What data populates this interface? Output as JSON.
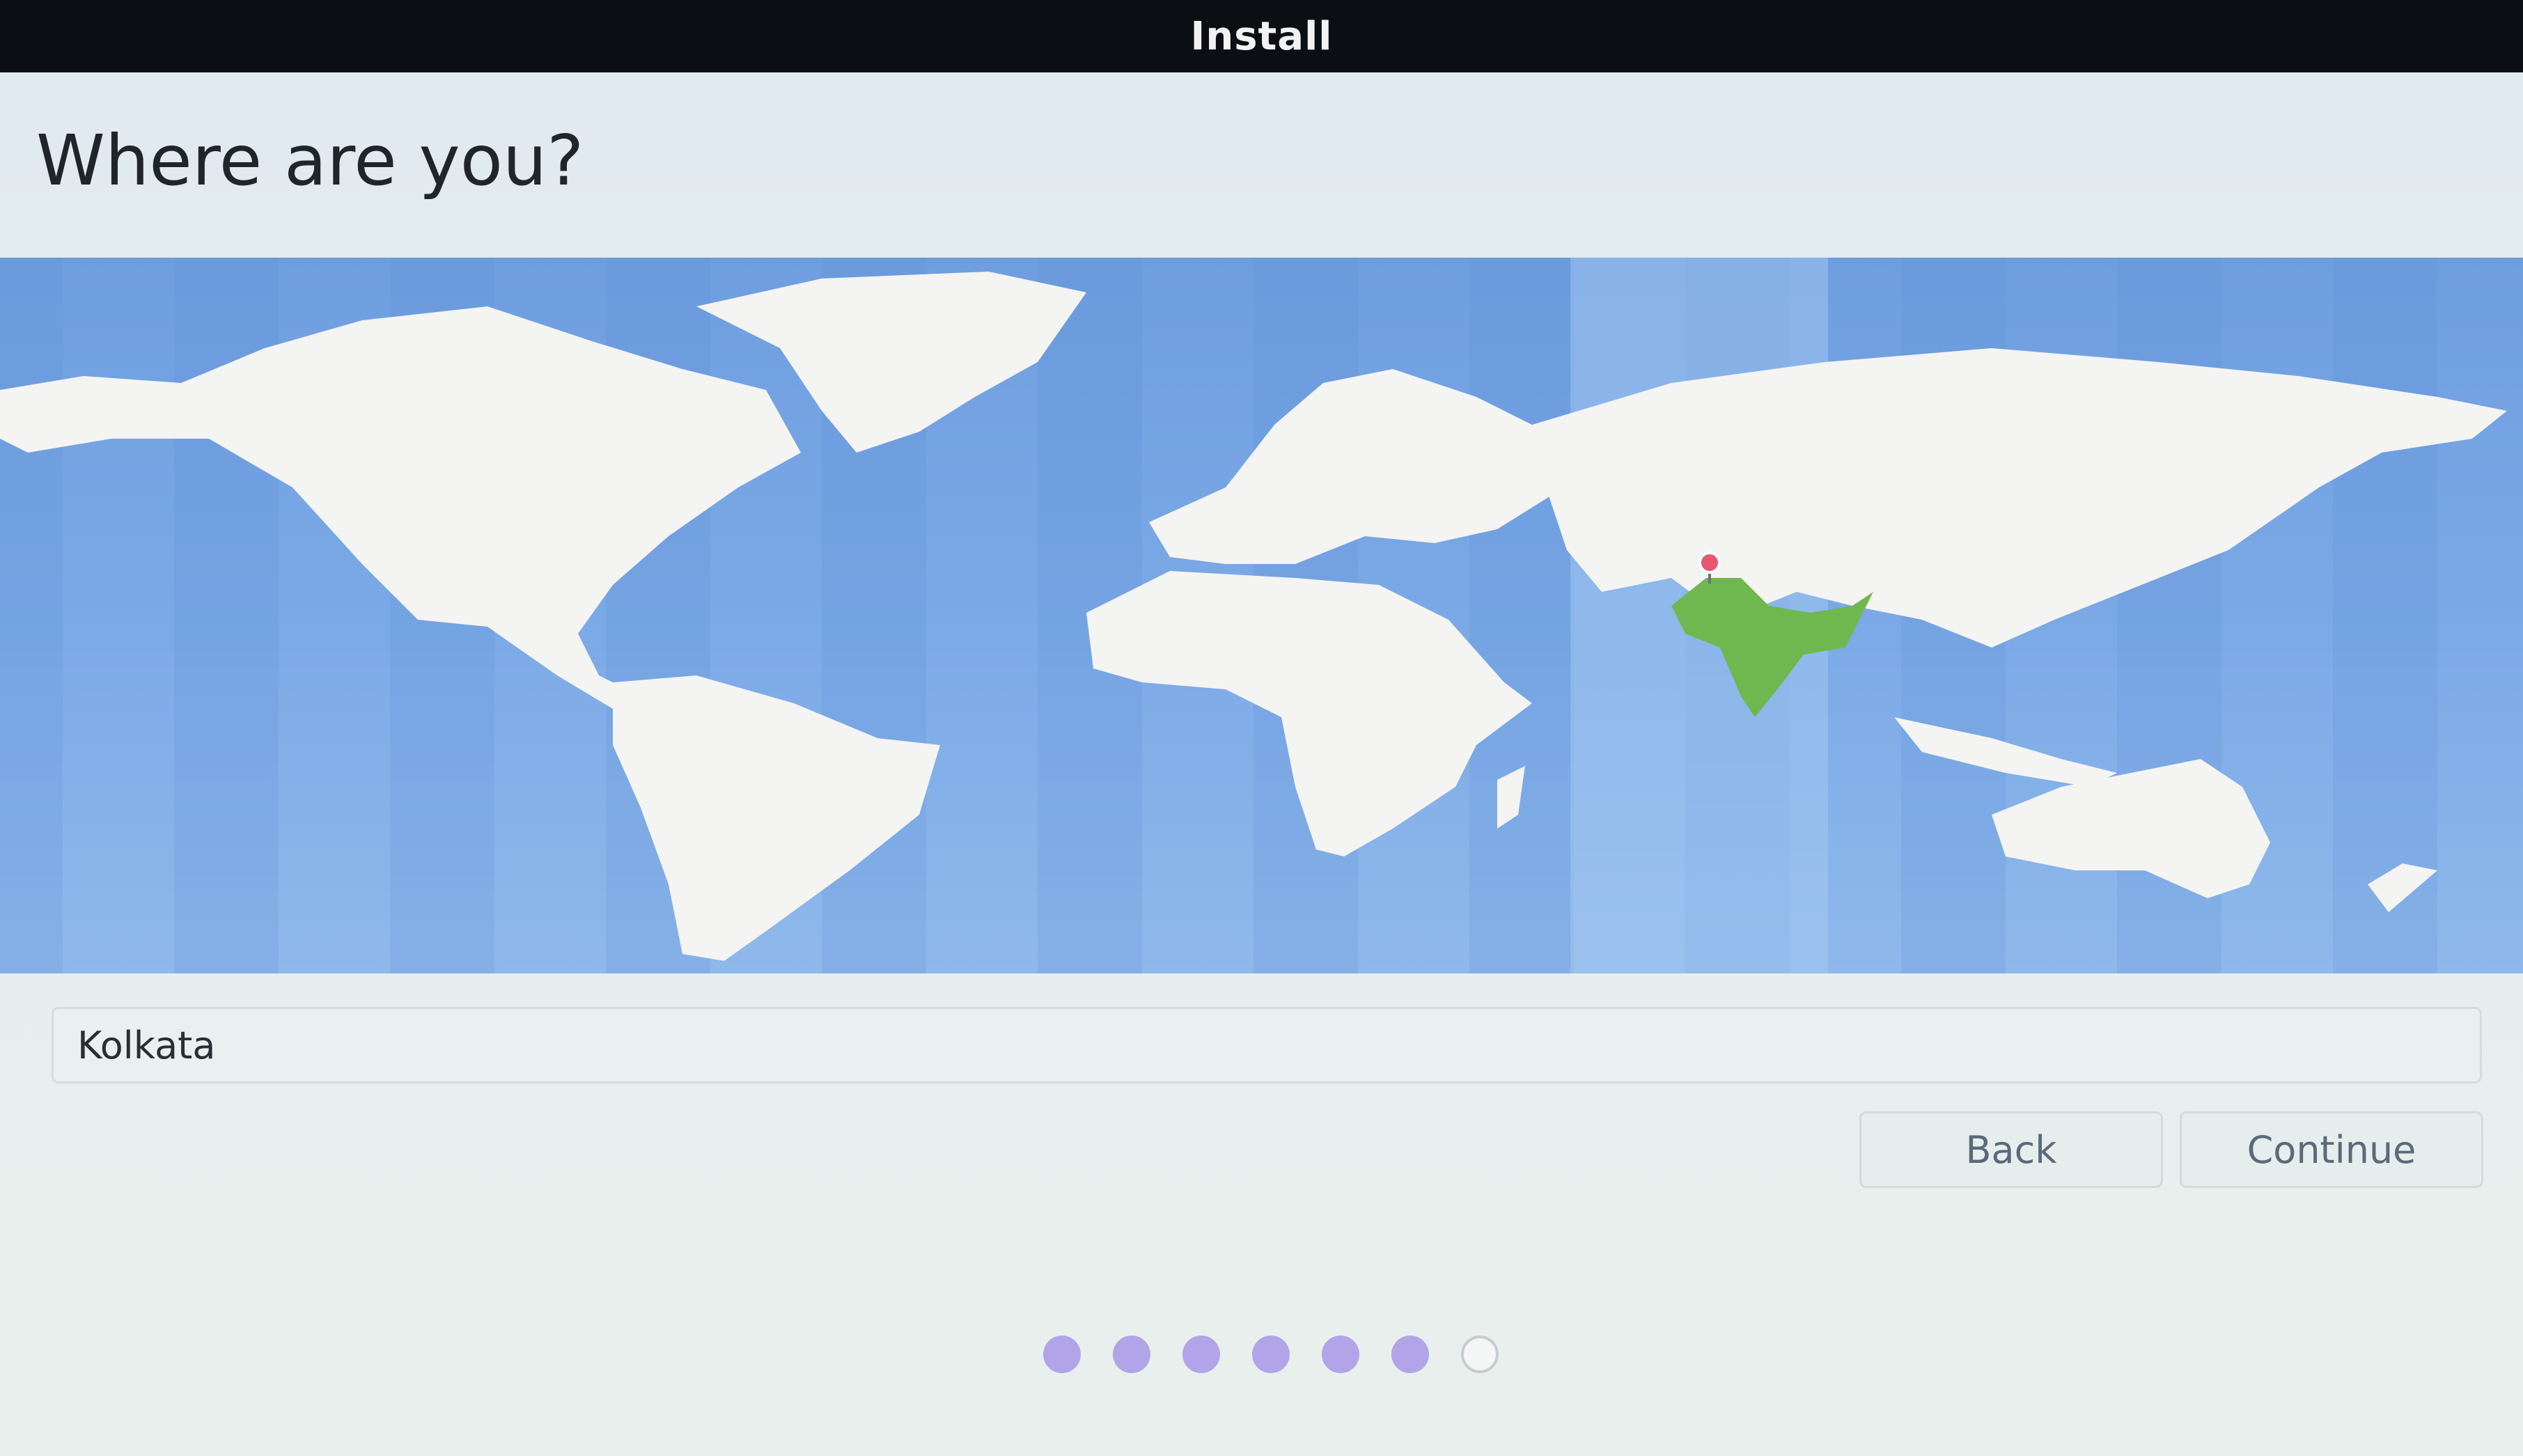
{
  "window": {
    "title": "Install"
  },
  "page": {
    "heading": "Where are you?"
  },
  "location": {
    "value": "Kolkata"
  },
  "buttons": {
    "back": "Back",
    "continue": "Continue"
  },
  "progress": {
    "completed_steps": 6,
    "total_steps": 7
  },
  "map": {
    "selected_country": "India",
    "colors": {
      "ocean": "#7ba9e6",
      "land": "#f4f4f2",
      "selected": "#6fb84f",
      "pin": "#e8566f"
    }
  }
}
